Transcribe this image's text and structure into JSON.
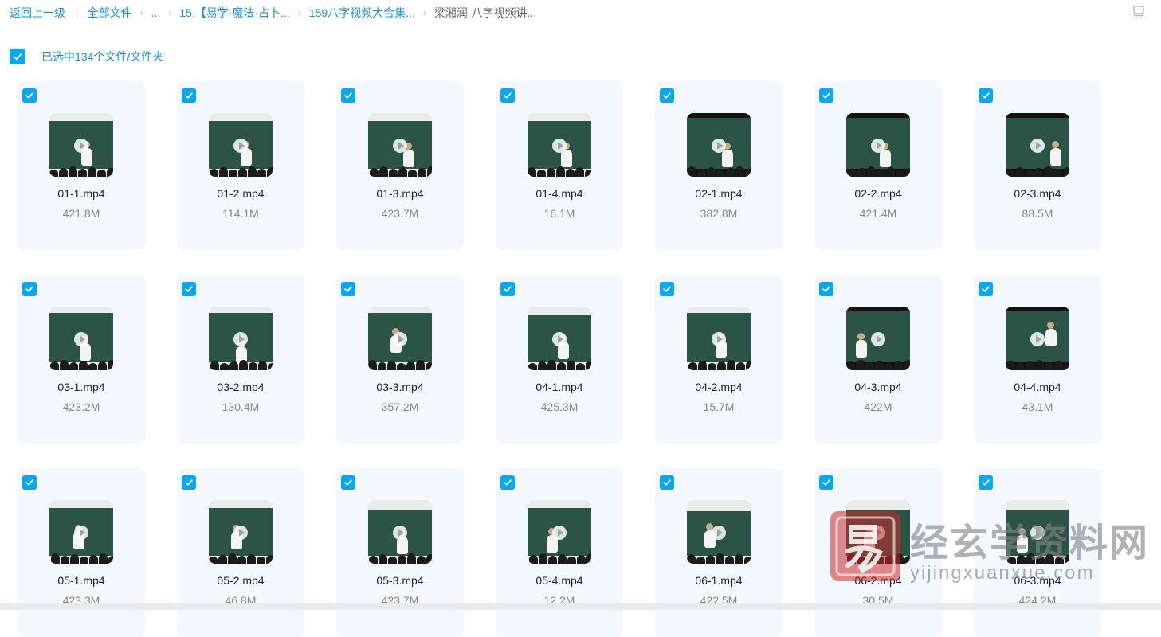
{
  "breadcrumb": {
    "back": "返回上一级",
    "separator": "|",
    "items": [
      "全部文件",
      "...",
      "15.【易学·魔法·占卜...",
      "159八字视频大合集...",
      "梁湘润-八字视频讲..."
    ]
  },
  "selection": {
    "label": "已选中134个文件/文件夹",
    "checked": true
  },
  "files": [
    {
      "name": "01-1.mp4",
      "size": "421.8M"
    },
    {
      "name": "01-2.mp4",
      "size": "114.1M"
    },
    {
      "name": "01-3.mp4",
      "size": "423.7M"
    },
    {
      "name": "01-4.mp4",
      "size": "16.1M"
    },
    {
      "name": "02-1.mp4",
      "size": "382.8M"
    },
    {
      "name": "02-2.mp4",
      "size": "421.4M"
    },
    {
      "name": "02-3.mp4",
      "size": "88.5M"
    },
    {
      "name": "03-1.mp4",
      "size": "423.2M"
    },
    {
      "name": "03-2.mp4",
      "size": "130.4M"
    },
    {
      "name": "03-3.mp4",
      "size": "357.2M"
    },
    {
      "name": "04-1.mp4",
      "size": "425.3M"
    },
    {
      "name": "04-2.mp4",
      "size": "15.7M"
    },
    {
      "name": "04-3.mp4",
      "size": "422M"
    },
    {
      "name": "04-4.mp4",
      "size": "43.1M"
    },
    {
      "name": "05-1.mp4",
      "size": "423.3M"
    },
    {
      "name": "05-2.mp4",
      "size": "46.8M"
    },
    {
      "name": "05-3.mp4",
      "size": "423.7M"
    },
    {
      "name": "05-4.mp4",
      "size": "12.2M"
    },
    {
      "name": "06-1.mp4",
      "size": "422.5M"
    },
    {
      "name": "06-2.mp4",
      "size": "30.5M"
    },
    {
      "name": "06-3.mp4",
      "size": "424.2M"
    }
  ],
  "watermark": {
    "title": "经玄学资料网",
    "url": "yijingxuanxue.com"
  },
  "colors": {
    "accent": "#09a6f2",
    "link": "#1890d8",
    "card_bg": "#f3f8fe",
    "board": "#2c5446"
  },
  "icons": {
    "checkbox": "check-icon",
    "play": "play-icon",
    "view_toggle": "list-view-icon"
  }
}
